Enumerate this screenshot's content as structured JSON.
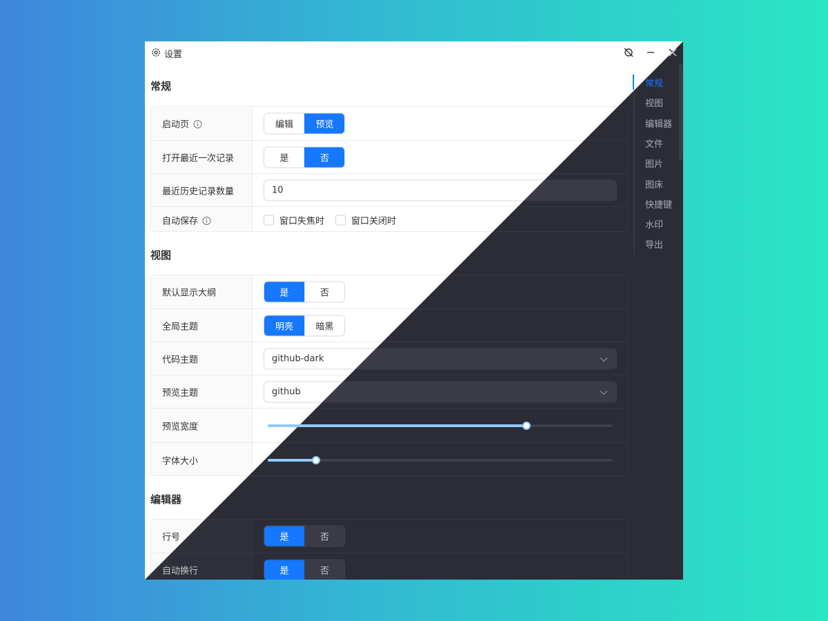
{
  "window": {
    "title": "设置"
  },
  "sections": {
    "general": {
      "title": "常规",
      "startup": {
        "label": "启动页",
        "options": [
          "编辑",
          "预览"
        ],
        "selected": 1
      },
      "open_last": {
        "label": "打开最近一次记录",
        "options": [
          "是",
          "否"
        ],
        "selected": 1
      },
      "history_count": {
        "label": "最近历史记录数量",
        "value": "10"
      },
      "autosave": {
        "label": "自动保存",
        "options": [
          "窗口失焦时",
          "窗口关闭时"
        ]
      }
    },
    "view": {
      "title": "视图",
      "outline": {
        "label": "默认显示大纲",
        "options": [
          "是",
          "否"
        ],
        "selected": 0
      },
      "theme": {
        "label": "全局主题",
        "options": [
          "明亮",
          "暗黑"
        ],
        "selected": 0
      },
      "code_theme": {
        "label": "代码主题",
        "value": "github-dark"
      },
      "preview_theme": {
        "label": "预览主题",
        "value": "github"
      },
      "preview_width": {
        "label": "预览宽度",
        "level": 0.75
      },
      "font_size": {
        "label": "字体大小",
        "level": 0.14
      }
    },
    "editor": {
      "title": "编辑器",
      "line_numbers": {
        "label": "行号",
        "options": [
          "是",
          "否"
        ],
        "selected": 0
      },
      "wrap": {
        "label": "自动换行",
        "options": [
          "是",
          "否"
        ],
        "selected": 0
      }
    }
  },
  "nav": {
    "items": [
      "常规",
      "视图",
      "编辑器",
      "文件",
      "图片",
      "图床",
      "快捷键",
      "水印",
      "导出"
    ],
    "active": 0
  },
  "colors": {
    "accent": "#1677ff",
    "slider": "#91caff",
    "dark_bg": "#2b2c36"
  },
  "icons": [
    "gear-icon",
    "pin-off-icon",
    "minimize-icon",
    "close-icon",
    "info-icon",
    "chevron-down-icon"
  ]
}
